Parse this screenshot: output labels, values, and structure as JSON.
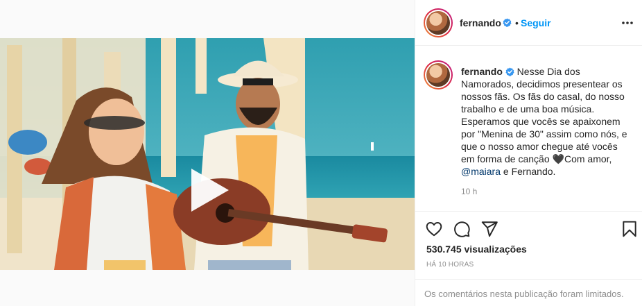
{
  "post": {
    "username": "fernando",
    "separator": "•",
    "follow_label": "Seguir",
    "caption_text": " Nesse Dia dos Namorados, decidimos presentear os nossos fãs. Os fãs do casal, do nosso trabalho e de uma boa música. Esperamos que vocês se apaixonem por \"Menina de 30\" assim como nós, e que o nosso amor chegue até vocês em forma de canção ",
    "caption_heart": "🖤",
    "caption_after_heart": "Com amor, ",
    "mention": "@maiara",
    "caption_end": " e Fernando.",
    "time_ago": "10 h",
    "views_count": "530.745",
    "views_label": "visualizações",
    "posted_ago": "HÁ 10 HORAS",
    "comments_limited": "Os comentários nesta publicação foram limitados."
  },
  "icons": {
    "verified": "verified-badge-icon",
    "more": "more-options-icon",
    "like": "heart-icon",
    "comment": "comment-icon",
    "share": "paper-plane-icon",
    "save": "bookmark-icon",
    "play": "play-icon"
  },
  "colors": {
    "accent_blue": "#0095f6",
    "verified_blue": "#3897f0",
    "mention": "#00376b",
    "muted": "#8e8e8e"
  }
}
